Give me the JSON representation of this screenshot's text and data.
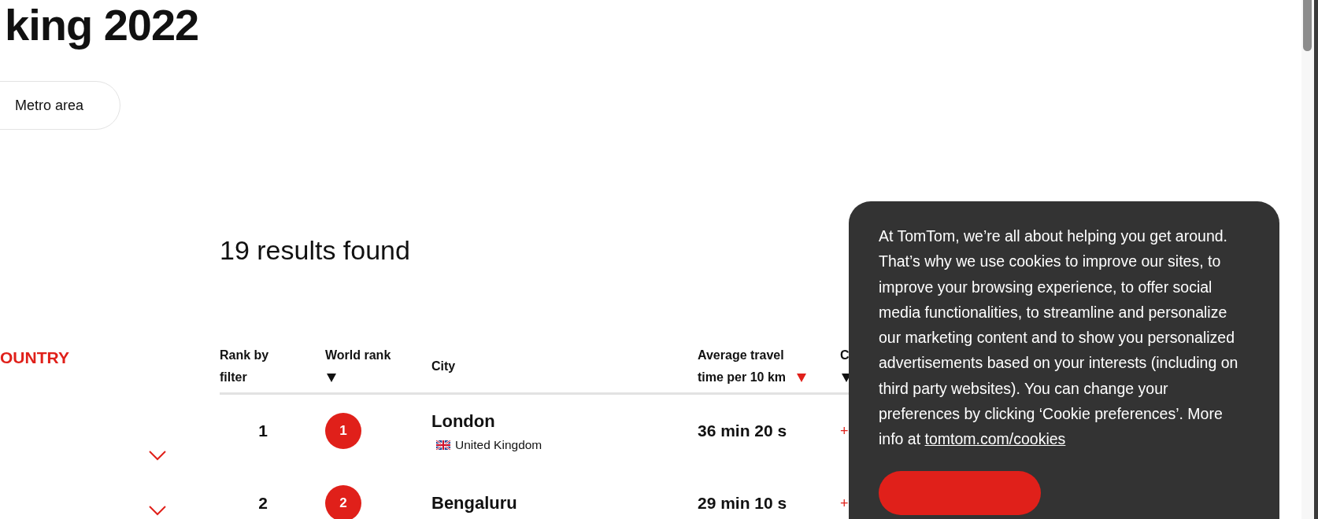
{
  "title": "king 2022",
  "filter_pill": {
    "label": "Metro area"
  },
  "results_heading": "19 results found",
  "sidebar": {
    "heading": "OUNTRY",
    "toggles": [
      {
        "expanded": false
      },
      {
        "expanded": false
      }
    ]
  },
  "table": {
    "columns": [
      {
        "label": "Rank by filter",
        "sortable": false
      },
      {
        "label": "World rank",
        "sortable": true,
        "selected": false
      },
      {
        "label": "City",
        "sortable": false
      },
      {
        "label": "Average travel time per 10 km",
        "sortable": true,
        "selected": true
      },
      {
        "label": "C",
        "sortable": true,
        "selected": false
      }
    ],
    "rows": [
      {
        "rank": "1",
        "world_rank": "1",
        "city": "London",
        "country": "United Kingdom",
        "time": "36 min 20 s",
        "column_5": "+"
      },
      {
        "rank": "2",
        "world_rank": "2",
        "city": "Bengaluru",
        "time": "29 min 10 s",
        "column_5": "+"
      }
    ]
  },
  "cookie_banner": {
    "text": "At TomTom, we’re all about helping you get around. That’s why we use cookies to improve our sites, to improve your browsing experience, to offer social media functionalities, to streamline and personalize our marketing content and to show you personalized advertisements based on your interests (including on third party websites). You can change your preferences by clicking ‘Cookie preferences’. More info at",
    "link": "tomtom.com/cookies"
  }
}
